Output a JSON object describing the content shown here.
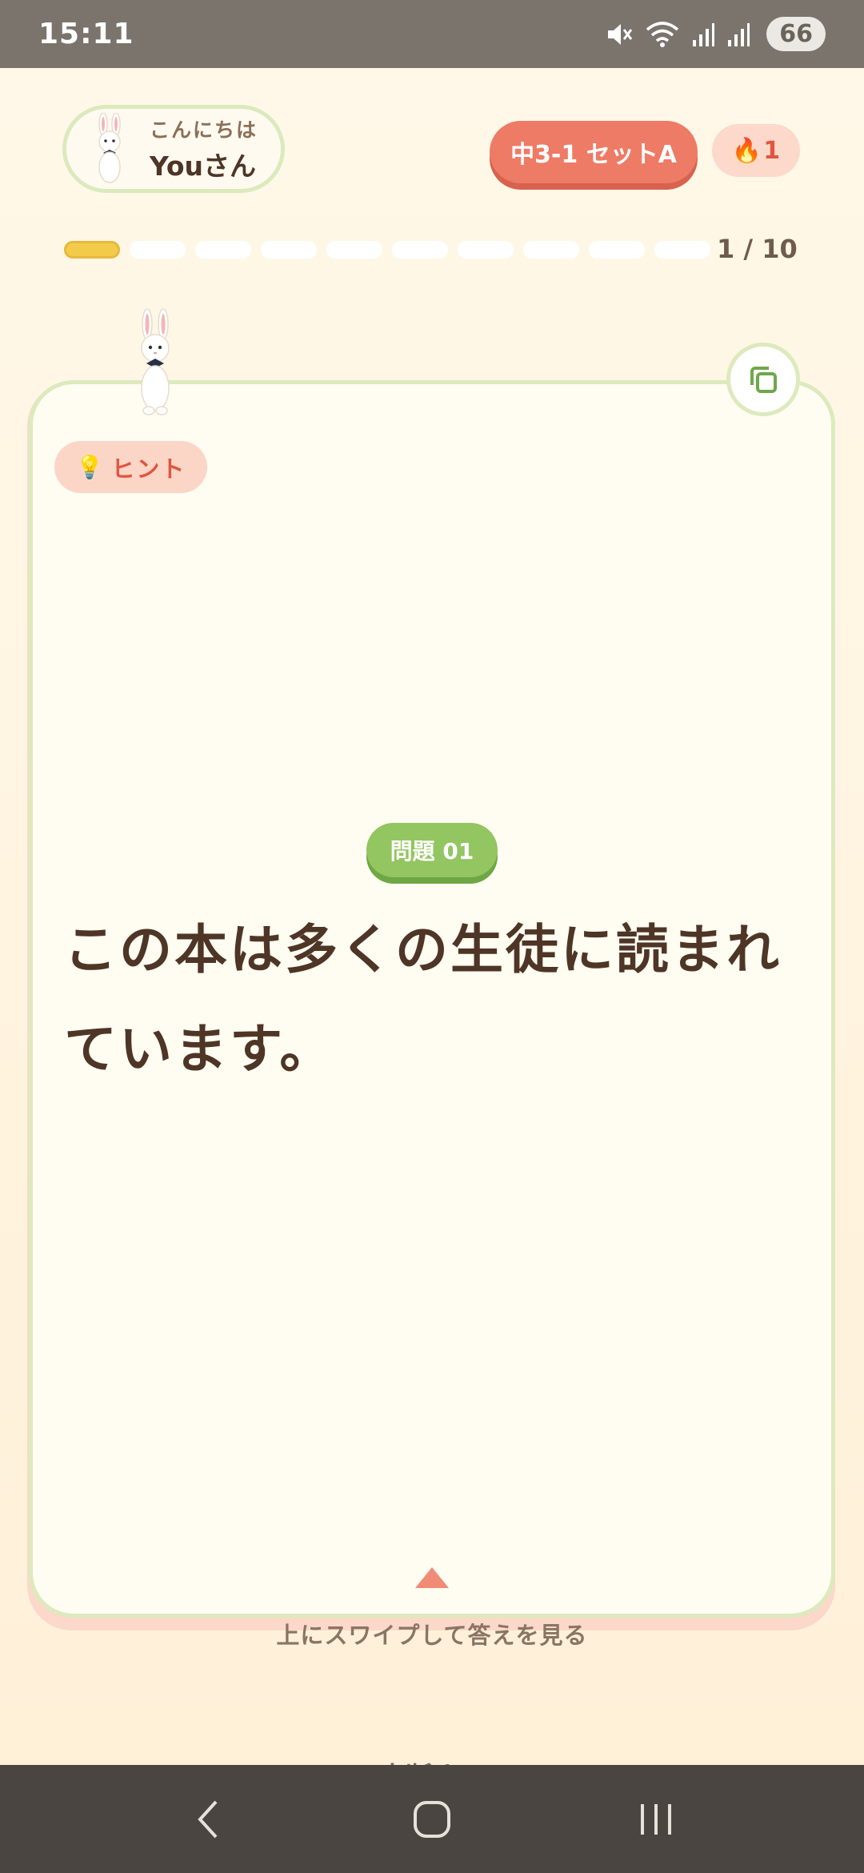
{
  "status_bar": {
    "time": "15:11",
    "battery": "66",
    "icons": [
      "mute-icon",
      "wifi-icon",
      "signal-icon",
      "signal-icon"
    ]
  },
  "header": {
    "greeting": "こんにちは",
    "user_name": "Youさん",
    "set_label": "中3-1 セットA",
    "streak_count": "1",
    "streak_icon": "fire-icon"
  },
  "progress": {
    "current": 1,
    "total": 10,
    "label": "1 / 10"
  },
  "card": {
    "hint_label": "ヒント",
    "hint_icon": "lightbulb-icon",
    "question_badge": "問題 01",
    "question_text": "この本は多くの生徒に読まれています。",
    "swipe_hint": "上にスワイプして答えを見る"
  },
  "footer": {
    "quit_label": "中断する"
  },
  "colors": {
    "accent_coral": "#ee7b65",
    "accent_green": "#93c561",
    "progress_active": "#f2cb4a",
    "background": "#fff6e3"
  }
}
